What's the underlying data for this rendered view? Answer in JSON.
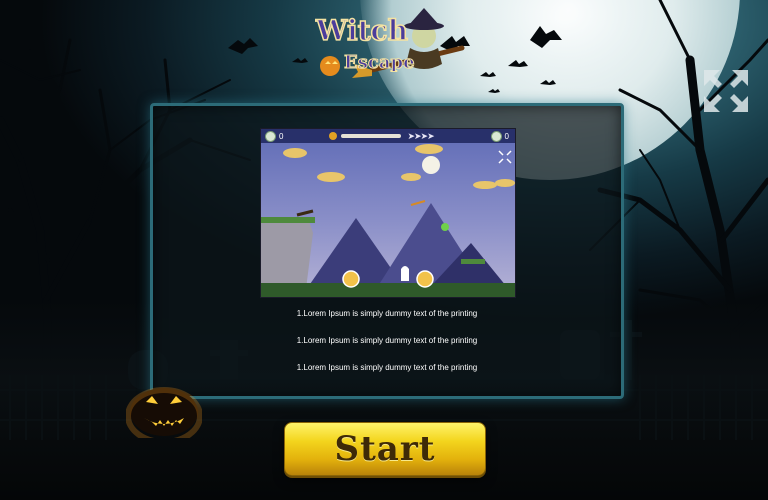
{
  "game": {
    "title_line1": "Witch",
    "title_line2": "Escape"
  },
  "preview": {
    "score_left": "0",
    "score_right": "0",
    "arrows": "➤➤➤➤"
  },
  "instructions": [
    "1.Lorem Ipsum is simply dummy text of the printing",
    "1.Lorem Ipsum is simply dummy text of the printing",
    "1.Lorem Ipsum is simply dummy text of the printing"
  ],
  "start_button": {
    "label": "Start"
  },
  "icons": {
    "fullscreen": "fullscreen-icon",
    "moon": "moon-icon",
    "pumpkin": "pumpkin-icon"
  },
  "colors": {
    "panel_border": "#2c6b78",
    "button_yellow": "#f3d51d",
    "button_text": "#3e2a07",
    "logo_purple": "#4b3c9c"
  }
}
